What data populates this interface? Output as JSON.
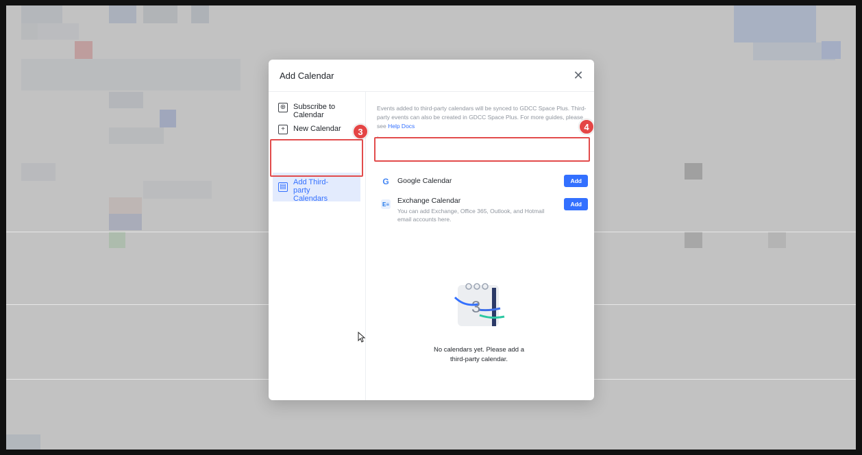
{
  "dialog": {
    "title": "Add Calendar",
    "close_icon": "close-icon"
  },
  "sidebar": {
    "items": [
      {
        "label": "Subscribe to Calendar",
        "icon": "subscribe-icon"
      },
      {
        "label": "New Calendar",
        "icon": "plus-square-icon"
      },
      {
        "label": "Add Third-party Calendars",
        "icon": "calendar-add-icon",
        "active": true
      }
    ]
  },
  "content": {
    "intro_text": "Events added to third-party calendars will be synced to GDCC Space Plus. Third-party events can also be created in GDCC Space Plus. For more guides, please see",
    "help_link": "Help Docs",
    "intro_suffix": ".",
    "providers": [
      {
        "name": "Google Calendar",
        "icon": "google-icon",
        "button": "Add"
      },
      {
        "name": "Exchange Calendar",
        "icon": "exchange-icon",
        "description": "You can add Exchange, Office 365, Outlook, and Hotmail email accounts here.",
        "button": "Add"
      }
    ],
    "empty_day": "3",
    "empty_text": "No calendars yet. Please add a third-party calendar."
  },
  "annotations": {
    "step_3": "3",
    "step_4": "4"
  },
  "colors": {
    "accent": "#3370ff",
    "highlight": "#e24b4b",
    "active_bg": "#e3ebfd"
  }
}
